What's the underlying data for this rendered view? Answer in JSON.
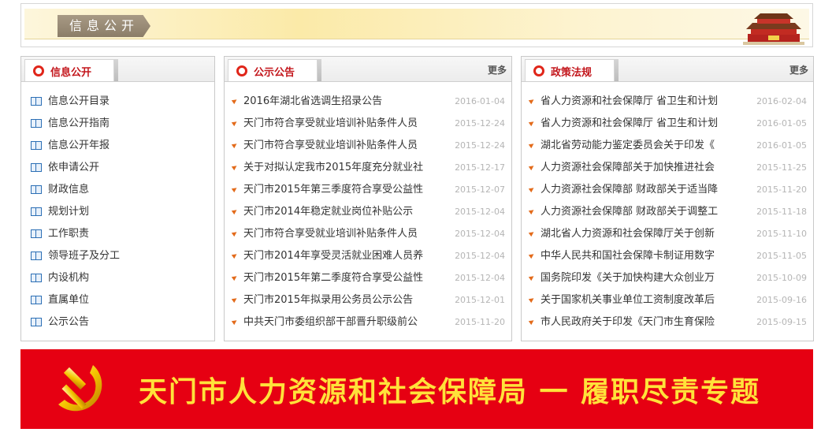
{
  "header": {
    "title": "信息公开"
  },
  "panels": {
    "info": {
      "title": "信息公开",
      "items": [
        "信息公开目录",
        "信息公开指南",
        "信息公开年报",
        "依申请公开",
        "财政信息",
        "规划计划",
        "工作职责",
        "领导班子及分工",
        "内设机构",
        "直属单位",
        "公示公告"
      ]
    },
    "notice": {
      "title": "公示公告",
      "more": "更多",
      "items": [
        {
          "title": "2016年湖北省选调生招录公告",
          "date": "2016-01-04"
        },
        {
          "title": "天门市符合享受就业培训补贴条件人员",
          "date": "2015-12-24"
        },
        {
          "title": "天门市符合享受就业培训补贴条件人员",
          "date": "2015-12-24"
        },
        {
          "title": "关于对拟认定我市2015年度充分就业社",
          "date": "2015-12-17"
        },
        {
          "title": "天门市2015年第三季度符合享受公益性",
          "date": "2015-12-07"
        },
        {
          "title": "天门市2014年稳定就业岗位补贴公示",
          "date": "2015-12-04"
        },
        {
          "title": "天门市符合享受就业培训补贴条件人员",
          "date": "2015-12-04"
        },
        {
          "title": "天门市2014年享受灵活就业困难人员养",
          "date": "2015-12-04"
        },
        {
          "title": "天门市2015年第二季度符合享受公益性",
          "date": "2015-12-04"
        },
        {
          "title": "天门市2015年拟录用公务员公示公告",
          "date": "2015-12-01"
        },
        {
          "title": "中共天门市委组织部干部晋升职级前公",
          "date": "2015-11-20"
        }
      ]
    },
    "policy": {
      "title": "政策法规",
      "more": "更多",
      "items": [
        {
          "title": "省人力资源和社会保障厅 省卫生和计划",
          "date": "2016-02-04"
        },
        {
          "title": "省人力资源和社会保障厅 省卫生和计划",
          "date": "2016-01-05"
        },
        {
          "title": "湖北省劳动能力鉴定委员会关于印发《",
          "date": "2016-01-05"
        },
        {
          "title": "人力资源社会保障部关于加快推进社会",
          "date": "2015-11-25"
        },
        {
          "title": "人力资源社会保障部 财政部关于适当降",
          "date": "2015-11-20"
        },
        {
          "title": "人力资源社会保障部 财政部关于调整工",
          "date": "2015-11-18"
        },
        {
          "title": "湖北省人力资源和社会保障厅关于创新",
          "date": "2015-11-10"
        },
        {
          "title": "中华人民共和国社会保障卡制证用数字",
          "date": "2015-11-05"
        },
        {
          "title": "国务院印发《关于加快构建大众创业万",
          "date": "2015-10-09"
        },
        {
          "title": "关于国家机关事业单位工资制度改革后",
          "date": "2015-09-16"
        },
        {
          "title": "市人民政府关于印发《天门市生育保险",
          "date": "2015-09-15"
        }
      ]
    }
  },
  "footer": {
    "banner_text": "天门市人力资源和社会保障局 一 履职尽责专题"
  },
  "colors": {
    "accent_red": "#e60012",
    "title_red": "#c3161c",
    "banner_yellow": "#ffe23a"
  }
}
